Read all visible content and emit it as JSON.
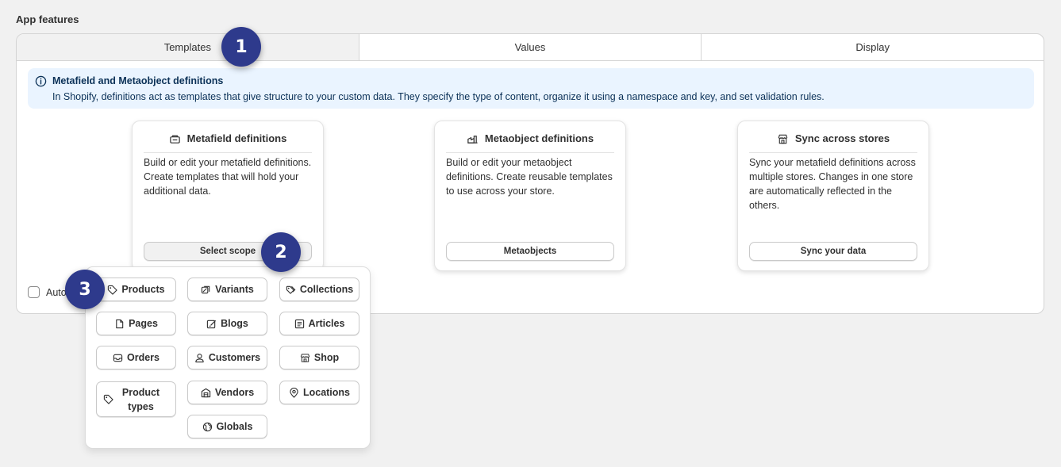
{
  "section_title": "App features",
  "tabs": [
    {
      "label": "Templates",
      "active": true
    },
    {
      "label": "Values",
      "active": false
    },
    {
      "label": "Display",
      "active": false
    }
  ],
  "banner": {
    "icon": "info-icon",
    "title": "Metafield and Metaobject definitions",
    "text": "In Shopify, definitions act as templates that give structure to your custom data. They specify the type of content, organize it using a namespace and key, and set validation rules."
  },
  "cards": [
    {
      "title": "Metafield definitions",
      "icon": "metafield-icon",
      "body": "Build or edit your metafield definitions. Create templates that will hold your additional data.",
      "button": "Select scope"
    },
    {
      "title": "Metaobject definitions",
      "icon": "metaobject-icon",
      "body": "Build or edit your metaobject definitions. Create reusable templates to use across your store.",
      "button": "Metaobjects"
    },
    {
      "title": "Sync across stores",
      "icon": "store-icon",
      "body": "Sync your metafield definitions across multiple stores. Changes in one store are automatically reflected in the others.",
      "button": "Sync your data"
    }
  ],
  "auto_checkbox": {
    "label": "Auto",
    "checked": false
  },
  "scopes": [
    {
      "label": "Products",
      "icon": "tag-icon"
    },
    {
      "label": "Variants",
      "icon": "variants-icon"
    },
    {
      "label": "Collections",
      "icon": "collection-icon"
    },
    {
      "label": "Pages",
      "icon": "page-icon"
    },
    {
      "label": "Blogs",
      "icon": "blog-icon"
    },
    {
      "label": "Articles",
      "icon": "article-icon"
    },
    {
      "label": "Orders",
      "icon": "order-icon"
    },
    {
      "label": "Customers",
      "icon": "person-icon"
    },
    {
      "label": "Shop",
      "icon": "store-icon"
    },
    {
      "label": "Product types",
      "icon": "tag-icon"
    },
    {
      "label": "Vendors",
      "icon": "vendor-icon"
    },
    {
      "label": "Locations",
      "icon": "location-icon"
    },
    {
      "label": "Globals",
      "icon": "globe-icon"
    }
  ],
  "badges": [
    "1",
    "2",
    "3"
  ],
  "colors": {
    "badge": "#2e3a8c",
    "banner_bg": "#eaf4ff",
    "banner_text": "#0b3157"
  }
}
